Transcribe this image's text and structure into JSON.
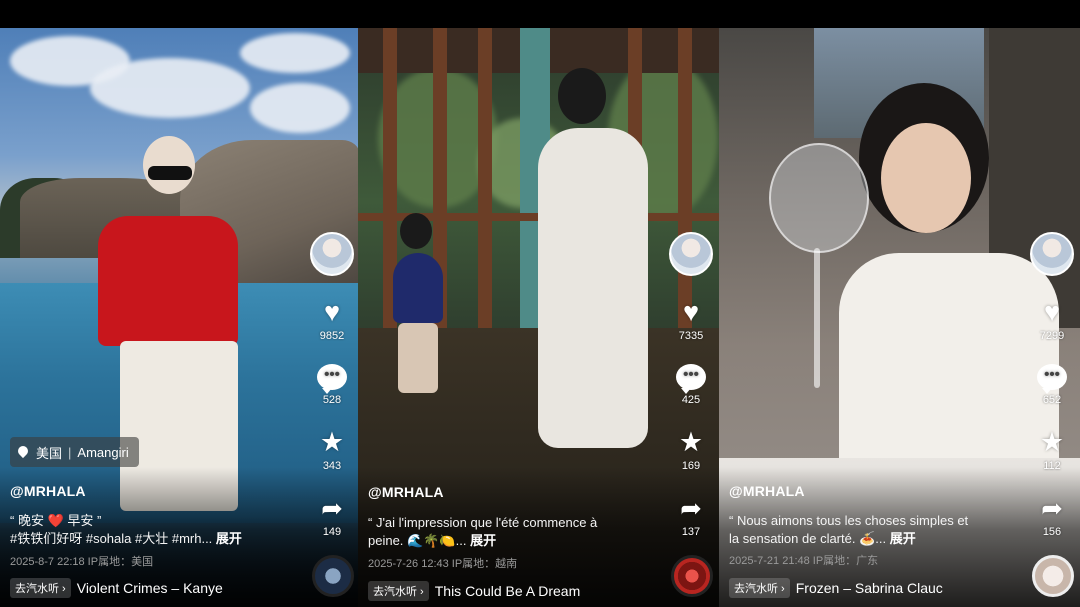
{
  "panels": [
    {
      "handle": "@MRHALA",
      "caption_line1": "“ 晚安 ❤️ 早安 ”",
      "caption_line2": "#铁铁们好呀 #sohala #大壮 #mrh...",
      "more": "展开",
      "meta": "2025-8-7 22:18  IP属地：美国",
      "music_tag": "去汽水听",
      "music_title": "Violent Crimes – Kanye",
      "likes": "9852",
      "comments": "528",
      "favorites": "343",
      "shares": "149",
      "location": {
        "country": "美国",
        "place": "Amangiri"
      }
    },
    {
      "handle": "@MRHALA",
      "caption_line1": "“ J'ai l'impression que l'été commence à",
      "caption_line2": "peine. 🌊🌴🍋...",
      "more": "展开",
      "meta": "2025-7-26 12:43  IP属地：越南",
      "music_tag": "去汽水听",
      "music_title": "This Could Be A Dream",
      "likes": "7335",
      "comments": "425",
      "favorites": "169",
      "shares": "137"
    },
    {
      "handle": "@MRHALA",
      "caption_line1": "“ Nous aimons tous les choses simples et",
      "caption_line2": "la sensation de clarté. 🍝...",
      "more": "展开",
      "meta": "2025-7-21 21:48  IP属地：广东",
      "music_tag": "去汽水听",
      "music_title": "Frozen – Sabrina Clauc",
      "likes": "7299",
      "comments": "652",
      "favorites": "112",
      "shares": "156"
    }
  ],
  "icons": {
    "like": "heart-icon",
    "comment": "comment-icon",
    "favorite": "star-icon",
    "share": "share-icon",
    "location": "location-pin-icon"
  }
}
